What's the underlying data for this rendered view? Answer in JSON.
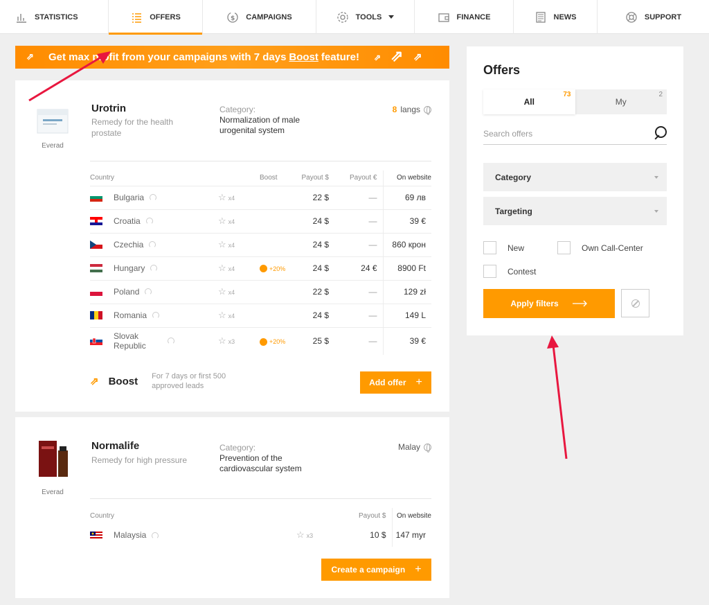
{
  "nav": {
    "items": [
      {
        "label": "STATISTICS",
        "icon": "bar-chart-icon"
      },
      {
        "label": "OFFERS",
        "icon": "list-icon",
        "active": true
      },
      {
        "label": "CAMPAIGNS",
        "icon": "money-cycle-icon"
      },
      {
        "label": "TOOLS",
        "icon": "gear-icon",
        "dropdown": true
      },
      {
        "label": "FINANCE",
        "icon": "wallet-icon"
      },
      {
        "label": "NEWS",
        "icon": "newspaper-icon"
      },
      {
        "label": "SUPPORT",
        "icon": "lifebuoy-icon"
      }
    ]
  },
  "banner": {
    "text_before": "Get max profit from your campaigns with 7 days",
    "text_boost": "Boost",
    "text_after": "feature!"
  },
  "offer1": {
    "name": "Urotrin",
    "desc": "Remedy for the health prostate",
    "brand": "Everad",
    "category_label": "Category:",
    "category": "Normalization of male urogenital system",
    "langs_count": "8",
    "langs_label": "langs",
    "headers": {
      "country": "Country",
      "boost": "Boost",
      "payout_usd": "Payout $",
      "payout_eur": "Payout €",
      "on_website": "On website"
    },
    "rows": [
      {
        "country": "Bulgaria",
        "mult": "x4",
        "boost": "",
        "usd": "22 $",
        "eur": "—",
        "web": "69 лв"
      },
      {
        "country": "Croatia",
        "mult": "x4",
        "boost": "",
        "usd": "24 $",
        "eur": "—",
        "web": "39 €"
      },
      {
        "country": "Czechia",
        "mult": "x4",
        "boost": "",
        "usd": "24 $",
        "eur": "—",
        "web": "860 крон"
      },
      {
        "country": "Hungary",
        "mult": "x4",
        "boost": "+20%",
        "usd": "24 $",
        "eur": "24 €",
        "web": "8900 Ft"
      },
      {
        "country": "Poland",
        "mult": "x4",
        "boost": "",
        "usd": "22 $",
        "eur": "—",
        "web": "129 zł"
      },
      {
        "country": "Romania",
        "mult": "x4",
        "boost": "",
        "usd": "24 $",
        "eur": "—",
        "web": "149 L"
      },
      {
        "country": "Slovak Republic",
        "mult": "x3",
        "boost": "+20%",
        "usd": "25 $",
        "eur": "—",
        "web": "39 €"
      }
    ],
    "boost_title": "Boost",
    "boost_note": "For 7 days or first 500 approved leads",
    "add_offer": "Add offer"
  },
  "offer2": {
    "name": "Normalife",
    "desc": "Remedy for high pressure",
    "brand": "Everad",
    "category_label": "Category:",
    "category": "Prevention of the cardiovascular system",
    "langs_label": "Malay",
    "headers": {
      "country": "Country",
      "payout_usd": "Payout $",
      "on_website": "On website"
    },
    "rows": [
      {
        "country": "Malaysia",
        "mult": "x3",
        "usd": "10 $",
        "web": "147 myr"
      }
    ],
    "create_campaign": "Create a campaign"
  },
  "panel": {
    "title": "Offers",
    "tab_all": "All",
    "tab_all_count": "73",
    "tab_my": "My",
    "tab_my_count": "2",
    "search_placeholder": "Search offers",
    "category": "Category",
    "targeting": "Targeting",
    "check_new": "New",
    "check_callcenter": "Own Call-Center",
    "check_contest": "Contest",
    "apply": "Apply filters"
  },
  "colors": {
    "accent": "#ff9a00",
    "annotation": "#e8173f"
  }
}
